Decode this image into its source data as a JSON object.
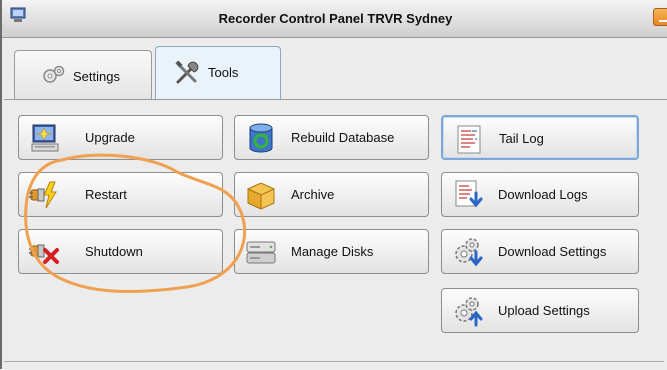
{
  "window": {
    "title": "Recorder Control Panel TRVR Sydney",
    "accent_color": "#f0901e"
  },
  "tabs": [
    {
      "label": "Settings",
      "icon": "gear-icon",
      "selected": false
    },
    {
      "label": "Tools",
      "icon": "tools-icon",
      "selected": true
    }
  ],
  "tools": {
    "upgrade": {
      "label": "Upgrade",
      "icon": "computer-icon"
    },
    "restart": {
      "label": "Restart",
      "icon": "restart-icon"
    },
    "shutdown": {
      "label": "Shutdown",
      "icon": "shutdown-icon"
    },
    "rebuild_database": {
      "label": "Rebuild Database",
      "icon": "database-icon"
    },
    "archive": {
      "label": "Archive",
      "icon": "box-icon"
    },
    "manage_disks": {
      "label": "Manage Disks",
      "icon": "disks-icon"
    },
    "tail_log": {
      "label": "Tail Log",
      "icon": "log-icon"
    },
    "download_logs": {
      "label": "Download Logs",
      "icon": "download-log-icon"
    },
    "download_settings": {
      "label": "Download Settings",
      "icon": "download-settings-icon"
    },
    "upload_settings": {
      "label": "Upload Settings",
      "icon": "upload-settings-icon"
    }
  },
  "annotation": {
    "shape": "hand-drawn circle",
    "color": "#f0a050",
    "encloses": [
      "Restart",
      "Shutdown"
    ]
  }
}
